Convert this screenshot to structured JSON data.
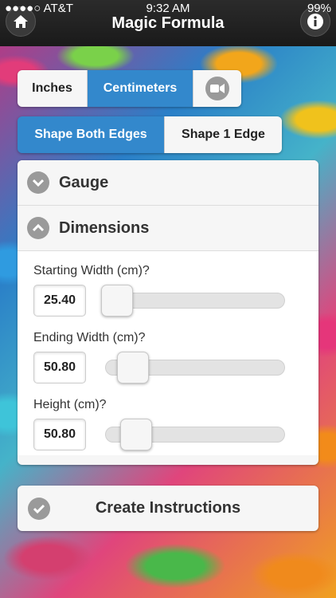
{
  "status_bar": {
    "carrier": "●●●●○ AT&T",
    "time": "9:32 AM",
    "battery": "99%"
  },
  "header": {
    "title": "Magic Formula",
    "home_icon": "home-icon",
    "info_icon": "info-icon"
  },
  "units": {
    "options": [
      "Inches",
      "Centimeters"
    ],
    "selected": "Centimeters",
    "video_icon": "video-camera-icon"
  },
  "shaping": {
    "options": [
      "Shape Both Edges",
      "Shape 1 Edge"
    ],
    "selected": "Shape Both Edges"
  },
  "sections": {
    "gauge": "Gauge",
    "dimensions": "Dimensions"
  },
  "fields": [
    {
      "label": "Starting Width (cm)?",
      "value": "25.40",
      "level": 0.0
    },
    {
      "label": "Ending Width (cm)?",
      "value": "50.80",
      "level": 0.1
    },
    {
      "label": "Height (cm)?",
      "value": "50.80",
      "level": 0.12
    }
  ],
  "actions": {
    "create": "Create Instructions"
  },
  "colors": {
    "accent": "#3388cc",
    "navbar": "#1f1f1f"
  }
}
